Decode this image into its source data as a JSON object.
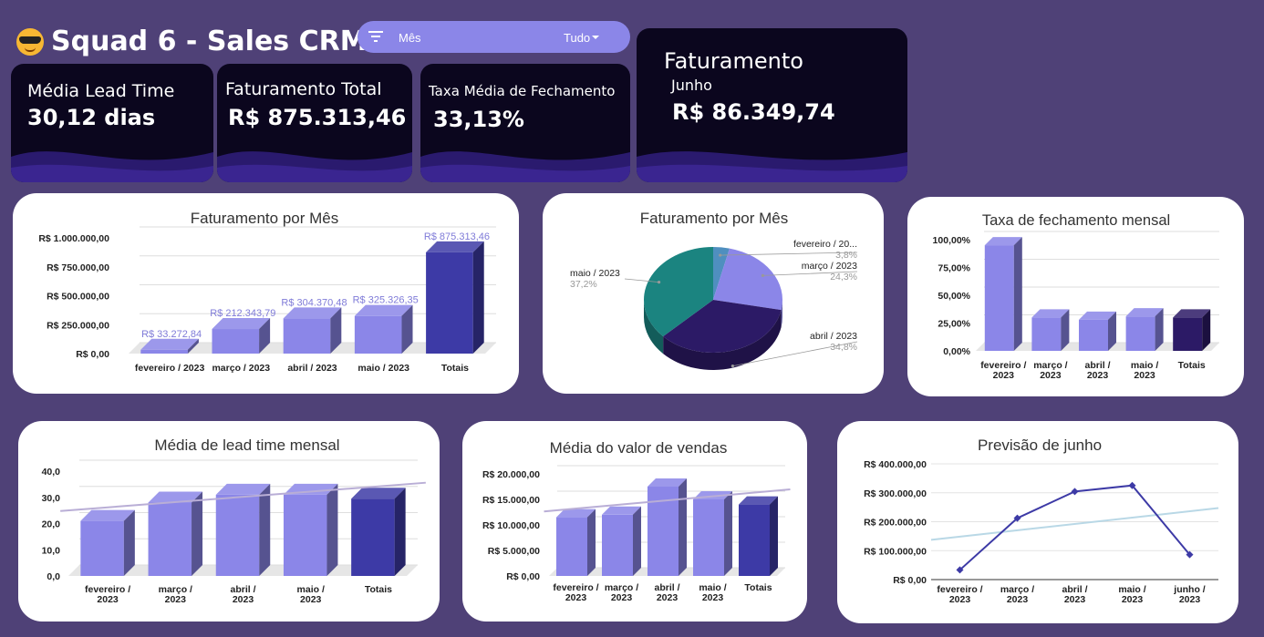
{
  "header": {
    "title": "Squad 6 - Sales CRM",
    "filter_label": "Mês",
    "filter_value": "Tudo"
  },
  "kpis": {
    "lead_time": {
      "label": "Média Lead Time",
      "value": "30,12 dias"
    },
    "revenue_total": {
      "label": "Faturamento Total",
      "value": "R$ 875.313,46"
    },
    "close_rate": {
      "label": "Taxa Média de Fechamento",
      "value": "33,13%"
    },
    "june": {
      "label": "Faturamento",
      "sublabel": "Junho",
      "value": "R$ 86.349,74"
    }
  },
  "chart_data": [
    {
      "id": "rev-bar",
      "type": "bar",
      "title": "Faturamento por Mês",
      "categories": [
        "fevereiro / 2023",
        "março / 2023",
        "abril / 2023",
        "maio / 2023",
        "Totais"
      ],
      "values": [
        33272.84,
        212343.79,
        304370.48,
        325326.35,
        875313.46
      ],
      "data_labels": [
        "R$ 33.272,84",
        "R$ 212.343,79",
        "R$ 304.370,48",
        "R$ 325.326,35",
        "R$ 875.313,46"
      ],
      "ylim": [
        0,
        1000000
      ],
      "yticks": [
        0,
        250000,
        500000,
        750000,
        1000000
      ],
      "ytick_labels": [
        "R$ 0,00",
        "R$ 250.000,00",
        "R$ 500.000,00",
        "R$ 750.000,00",
        "R$ 1.000.000,00"
      ]
    },
    {
      "id": "rev-pie",
      "type": "pie",
      "title": "Faturamento por Mês",
      "slices": [
        {
          "label": "fevereiro / 20...",
          "value": 3.8,
          "pct": "3,8%",
          "color": "#4f8fbf"
        },
        {
          "label": "março / 2023",
          "value": 24.3,
          "pct": "24,3%",
          "color": "#8b86e8"
        },
        {
          "label": "abril / 2023",
          "value": 34.8,
          "pct": "34,8%",
          "color": "#2c1a66"
        },
        {
          "label": "maio / 2023",
          "value": 37.2,
          "pct": "37,2%",
          "color": "#1b8480"
        }
      ]
    },
    {
      "id": "close-bar",
      "type": "bar",
      "title": "Taxa de fechamento mensal",
      "categories": [
        "fevereiro / 2023",
        "março / 2023",
        "abril / 2023",
        "maio / 2023",
        "Totais"
      ],
      "values": [
        95,
        30,
        28,
        31,
        30
      ],
      "ylim": [
        0,
        100
      ],
      "yticks": [
        0,
        25,
        50,
        75,
        100
      ],
      "ytick_labels": [
        "0,00%",
        "25,00%",
        "50,00%",
        "75,00%",
        "100,00%"
      ]
    },
    {
      "id": "lead-bar",
      "type": "bar",
      "title": "Média de lead time mensal",
      "categories": [
        "fevereiro / 2023",
        "março / 2023",
        "abril / 2023",
        "maio / 2023",
        "Totais"
      ],
      "values": [
        21,
        28,
        31,
        31,
        29.5
      ],
      "ylim": [
        0,
        40
      ],
      "yticks": [
        0,
        10,
        20,
        30,
        40
      ],
      "ytick_labels": [
        "0,0",
        "10,0",
        "20,0",
        "30,0",
        "40,0"
      ],
      "trendline": true
    },
    {
      "id": "avg-bar",
      "type": "bar",
      "title": "Média do valor de vendas",
      "categories": [
        "fevereiro / 2023",
        "março / 2023",
        "abril / 2023",
        "maio / 2023",
        "Totais"
      ],
      "values": [
        11500,
        12000,
        17500,
        15000,
        14000
      ],
      "ylim": [
        0,
        20000
      ],
      "yticks": [
        0,
        5000,
        10000,
        15000,
        20000
      ],
      "ytick_labels": [
        "R$ 0,00",
        "R$ 5.000,00",
        "R$ 10.000,00",
        "R$ 15.000,00",
        "R$ 20.000,00"
      ],
      "trendline": true
    },
    {
      "id": "forecast-line",
      "type": "line",
      "title": "Previsão de junho",
      "categories": [
        "fevereiro / 2023",
        "março / 2023",
        "abril / 2023",
        "maio / 2023",
        "junho / 2023"
      ],
      "values": [
        33272.84,
        212343.79,
        304370.48,
        325326.35,
        86349.74
      ],
      "ylim": [
        0,
        400000
      ],
      "yticks": [
        0,
        100000,
        200000,
        300000,
        400000
      ],
      "ytick_labels": [
        "R$ 0,00",
        "R$ 100.000,00",
        "R$ 200.000,00",
        "R$ 300.000,00",
        "R$ 400.000,00"
      ],
      "trendline": true
    }
  ],
  "colors": {
    "background": "#4f4177",
    "kpi_bg": "#0b061e",
    "bar": "#8b86e8",
    "bar_total": "#3d3aa6",
    "bar_total_close": "#2c1a66",
    "trend": "#b9aed6",
    "line": "#3d3aa6",
    "line_trend": "#b9d8e6"
  }
}
